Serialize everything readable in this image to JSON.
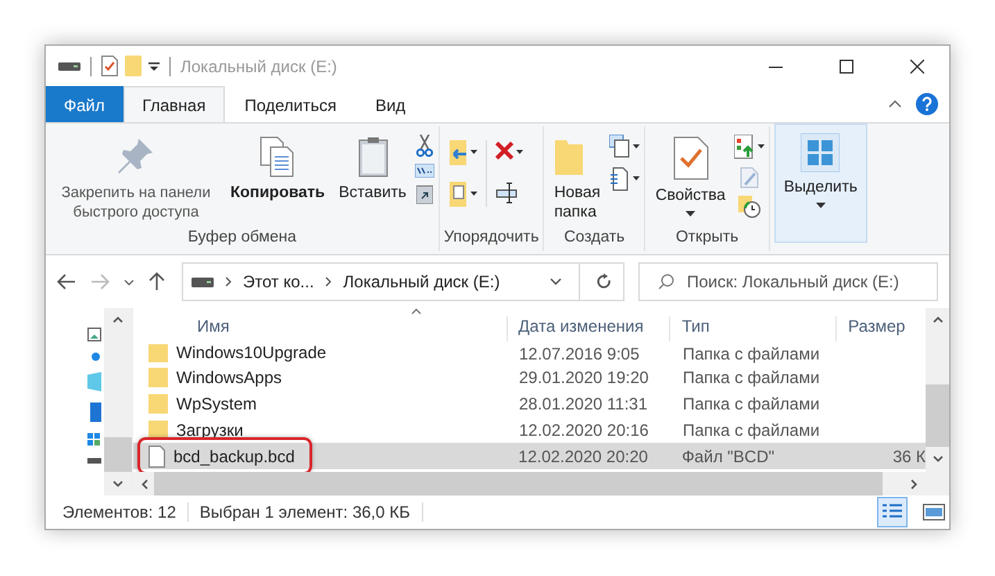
{
  "window": {
    "title": "Локальный диск (E:)"
  },
  "tabs": [
    {
      "label": "Файл",
      "kind": "file",
      "selected": false
    },
    {
      "label": "Главная",
      "kind": "tab",
      "selected": true
    },
    {
      "label": "Поделиться",
      "kind": "tab",
      "selected": false
    },
    {
      "label": "Вид",
      "kind": "tab",
      "selected": false
    }
  ],
  "ribbon": [
    {
      "label": "Буфер обмена",
      "kind": "clipboard",
      "buttons": [
        {
          "label": "Закрепить на панели быстрого доступа",
          "kind": "pin",
          "selected": false
        },
        {
          "label": "Копировать",
          "kind": "copy",
          "selected": false
        },
        {
          "label": "Вставить",
          "kind": "paste",
          "selected": false
        }
      ]
    },
    {
      "label": "Упорядочить",
      "kind": "organize"
    },
    {
      "label": "Создать",
      "kind": "new",
      "buttons": [
        {
          "label": "Новая папка",
          "kind": "folder",
          "selected": false
        }
      ]
    },
    {
      "label": "Открыть",
      "kind": "open",
      "buttons": [
        {
          "label": "Свойства",
          "kind": "properties",
          "selected": false
        }
      ]
    },
    {
      "kind": "select",
      "buttons": [
        {
          "label": "Выделить",
          "kind": "select",
          "selected": true
        }
      ]
    }
  ],
  "address": {
    "path": [
      "Этот ко...",
      "Локальный диск (E:)"
    ]
  },
  "search": {
    "placeholder": "Поиск: Локальный диск (E:)"
  },
  "table": {
    "columns": [
      "Имя",
      "Дата изменения",
      "Тип",
      "Размер"
    ],
    "rows": [
      {
        "name": "Windows10Upgrade",
        "date": "12.07.2016 9:05",
        "type": "Папка с файлами",
        "kind": "folder",
        "selected": false
      },
      {
        "name": "WindowsApps",
        "date": "29.01.2020 19:20",
        "type": "Папка с файлами",
        "kind": "folder",
        "selected": false
      },
      {
        "name": "WpSystem",
        "date": "28.01.2020 11:31",
        "type": "Папка с файлами",
        "kind": "folder",
        "selected": false
      },
      {
        "name": "Загрузки",
        "date": "12.02.2020 20:16",
        "type": "Папка с файлами",
        "kind": "folder",
        "selected": false
      },
      {
        "name": "bcd_backup.bcd",
        "date": "12.02.2020 20:20",
        "type": "Файл \"BCD\"",
        "size": "36 К",
        "kind": "file",
        "selected": true
      }
    ]
  },
  "status_bar": {
    "count": "Элементов: 12",
    "selection": "Выбран 1 элемент: 36,0 КБ"
  },
  "views": [
    {
      "kind": "details",
      "selected": true
    },
    {
      "kind": "tiles",
      "selected": false
    }
  ]
}
